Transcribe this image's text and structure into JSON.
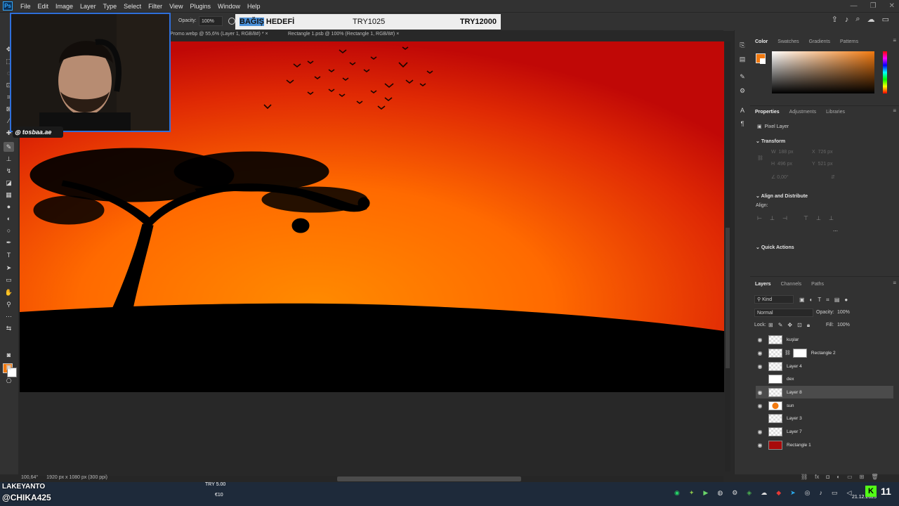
{
  "app": {
    "logo": "Ps"
  },
  "menu": [
    "File",
    "Edit",
    "Image",
    "Layer",
    "Type",
    "Select",
    "Filter",
    "View",
    "Plugins",
    "Window",
    "Help"
  ],
  "window_controls": [
    "—",
    "❐",
    "✕"
  ],
  "options_bar": {
    "opacity_label": "Opacity:",
    "opacity_value": "100%"
  },
  "donation_goal": {
    "label_highlight": "BAĞIŞ",
    "label_rest": " HEDEFİ",
    "current": "TRY1025",
    "goal": "TRY12000"
  },
  "tabs": [
    {
      "label": "Promo.webp @ 55,6% (Layer 1, RGB/8#) *",
      "close": "×"
    },
    {
      "label": "Rectangle 1.psb @ 100% (Rectangle 1, RGB/8#)",
      "close": "×"
    }
  ],
  "webcam": {
    "handle": "tosbaa.ae"
  },
  "status": {
    "zoom": "100,64°",
    "doc_info": "1920 px x 1080 px (300 ppi)"
  },
  "color_panel": {
    "tabs": [
      "Color",
      "Swatches",
      "Gradients",
      "Patterns"
    ],
    "active": "Color",
    "foreground": "#f27a10",
    "background": "#ffffff"
  },
  "properties_panel": {
    "tabs": [
      "Properties",
      "Adjustments",
      "Libraries"
    ],
    "active": "Properties",
    "layer_type": "Pixel Layer",
    "transform_title": "Transform",
    "w_label": "W",
    "w_value": "188 px",
    "x_label": "X",
    "x_value": "726 px",
    "h_label": "H",
    "h_value": "496 px",
    "y_label": "Y",
    "y_value": "521 px",
    "angle_value": "0,00°",
    "align_title": "Align and Distribute",
    "align_label": "Align:",
    "quick_actions_title": "Quick Actions"
  },
  "layers_panel": {
    "tabs": [
      "Layers",
      "Channels",
      "Paths"
    ],
    "active": "Layers",
    "filter": "Kind",
    "blend_mode": "Normal",
    "opacity_label": "Opacity:",
    "opacity_value": "100%",
    "lock_label": "Lock:",
    "fill_label": "Fill:",
    "fill_value": "100%",
    "layers": [
      {
        "name": "kuşlar",
        "visible": true,
        "selected": false
      },
      {
        "name": "Rectangle 2",
        "visible": true,
        "selected": false
      },
      {
        "name": "Layer 4",
        "visible": true,
        "selected": false
      },
      {
        "name": "dex",
        "visible": false,
        "selected": false
      },
      {
        "name": "Layer 8",
        "visible": true,
        "selected": true
      },
      {
        "name": "sun",
        "visible": true,
        "selected": false
      },
      {
        "name": "Layer 3",
        "visible": false,
        "selected": false
      },
      {
        "name": "Layer 7",
        "visible": true,
        "selected": false
      },
      {
        "name": "Rectangle 1",
        "visible": true,
        "selected": false
      }
    ]
  },
  "stream_overlay": {
    "user_top": "LAKEYANTO",
    "user_bottom": "@CHIKA425",
    "tip_amount": "TRY 5.00",
    "tip_euro": "€10"
  },
  "taskbar": {
    "date": "21.12.2025",
    "kick_logo": "K",
    "windows_logo": "11"
  },
  "colors": {
    "sky_top": "#cc0a06",
    "sky_mid": "#ff6a00",
    "ground": "#000000",
    "accent": "#31a8ff"
  }
}
